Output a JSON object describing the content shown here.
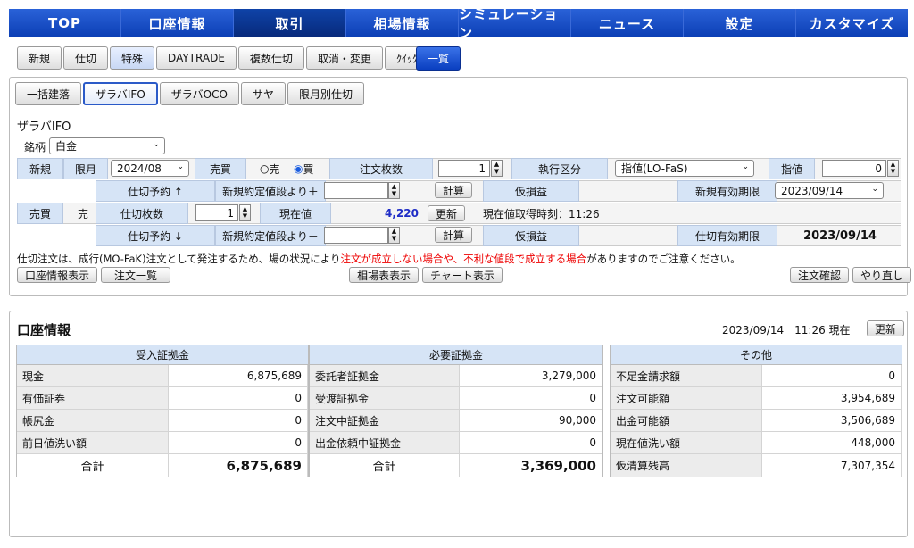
{
  "nav": [
    "TOP",
    "口座情報",
    "取引",
    "相場情報",
    "シミュレーション",
    "ニュース",
    "設定",
    "カスタマイズ"
  ],
  "subtabs": [
    "新規",
    "仕切",
    "特殊",
    "DAYTRADE",
    "複数仕切",
    "取消・変更",
    "ｸｲｯｸ"
  ],
  "list_button": "一覧",
  "panel_tabs": [
    "一括建落",
    "ザラバIFO",
    "ザラバOCO",
    "サヤ",
    "限月別仕切"
  ],
  "form": {
    "title": "ザラバIFO",
    "brand_label": "銘柄",
    "brand_value": "白金",
    "row1": {
      "new": "新規",
      "month_label": "限月",
      "month": "2024/08",
      "side_label": "売買",
      "sell": "売",
      "buy": "買",
      "qty_label": "注文枚数",
      "qty": "1",
      "exec_label": "執行区分",
      "exec": "指値(LO-FaS)",
      "limit_label": "指値",
      "limit": "0"
    },
    "row2": {
      "reserve": "仕切予約 ↑",
      "price_label": "新規約定値段より＋",
      "calc": "計算",
      "pl_label": "仮損益",
      "expiry_label": "新規有効期限",
      "expiry": "2023/09/14"
    },
    "row3": {
      "side_label": "売買",
      "side": "売",
      "qty_label": "仕切枚数",
      "qty": "1",
      "price_label": "現在値",
      "price": "4,220",
      "refresh": "更新",
      "time_label": "現在値取得時刻：11:26"
    },
    "row4": {
      "reserve": "仕切予約 ↓",
      "price_label": "新規約定値段より－",
      "calc": "計算",
      "pl_label": "仮損益",
      "expiry_label": "仕切有効期限",
      "expiry": "2023/09/14"
    },
    "notice_a": "仕切注文は、成行(MO-FaK)注文として発注するため、場の状況により",
    "notice_b": "注文が成立しない場合や、不利な値段で成立する場合",
    "notice_c": "がありますのでご注意ください。",
    "buttons": {
      "account": "口座情報表示",
      "orders": "注文一覧",
      "quotes": "相場表表示",
      "chart": "チャート表示",
      "confirm": "注文確認",
      "redo": "やり直し"
    }
  },
  "account": {
    "title": "口座情報",
    "timestamp": "2023/09/14　11:26 現在",
    "refresh": "更新",
    "received": {
      "header": "受入証拠金",
      "rows": [
        {
          "label": "現金",
          "value": "6,875,689"
        },
        {
          "label": "有価証券",
          "value": "0"
        },
        {
          "label": "帳尻金",
          "value": "0"
        },
        {
          "label": "前日値洗い額",
          "value": "0"
        }
      ],
      "total_label": "合計",
      "total": "6,875,689"
    },
    "required": {
      "header": "必要証拠金",
      "rows": [
        {
          "label": "委託者証拠金",
          "value": "3,279,000"
        },
        {
          "label": "受渡証拠金",
          "value": "0"
        },
        {
          "label": "注文中証拠金",
          "value": "90,000"
        },
        {
          "label": "出金依頼中証拠金",
          "value": "0"
        }
      ],
      "total_label": "合計",
      "total": "3,369,000"
    },
    "other": {
      "header": "その他",
      "rows": [
        {
          "label": "不足金請求額",
          "value": "0"
        },
        {
          "label": "注文可能額",
          "value": "3,954,689"
        },
        {
          "label": "出金可能額",
          "value": "3,506,689"
        },
        {
          "label": "現在値洗い額",
          "value": "448,000"
        },
        {
          "label": "仮清算残高",
          "value": "7,307,354"
        }
      ]
    }
  }
}
